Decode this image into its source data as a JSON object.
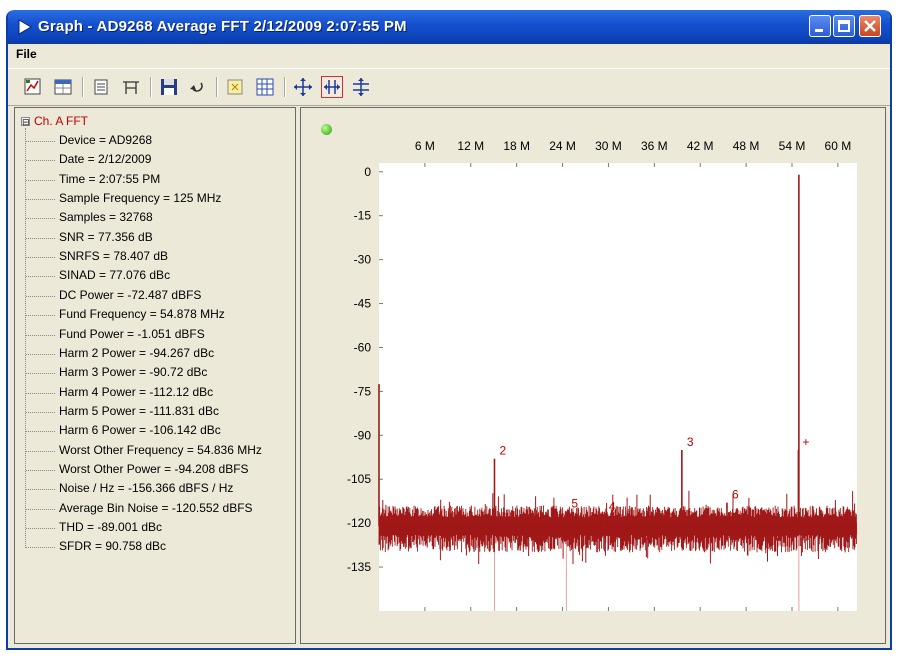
{
  "window": {
    "title": "Graph - AD9268 Average FFT 2/12/2009 2:07:55 PM",
    "title_color": "#ffffff",
    "titlebar_color": "#1551d0"
  },
  "menu": {
    "file": "File"
  },
  "toolbar": {
    "buttons": [
      "chart-icon",
      "table-icon",
      "list-icon",
      "tick-icon",
      "save-icon",
      "undo-icon",
      "marker-icon",
      "grid-icon",
      "zoom-fit-icon",
      "zoom-horizontal-icon",
      "zoom-vertical-icon"
    ],
    "active": "zoom-horizontal-icon"
  },
  "tree": {
    "root": "Ch. A FFT",
    "toggle": "⊟",
    "items": [
      "Device = AD9268",
      "Date = 2/12/2009",
      "Time = 2:07:55 PM",
      "Sample Frequency = 125 MHz",
      "Samples = 32768",
      "SNR = 77.356 dB",
      "SNRFS = 78.407 dB",
      "SINAD = 77.076 dBc",
      "DC Power = -72.487 dBFS",
      "Fund Frequency = 54.878 MHz",
      "Fund Power = -1.051 dBFS",
      "Harm 2 Power = -94.267 dBc",
      "Harm 3 Power = -90.72 dBc",
      "Harm 4 Power = -112.12 dBc",
      "Harm 5 Power = -111.831 dBc",
      "Harm 6 Power = -106.142 dBc",
      "Worst Other Frequency = 54.836 MHz",
      "Worst Other Power = -94.208 dBFS",
      "Noise / Hz = -156.366 dBFS / Hz",
      "Average Bin Noise = -120.552 dBFS",
      "THD = -89.001 dBc",
      "SFDR = 90.758 dBc"
    ]
  },
  "chart_data": {
    "type": "line",
    "x_ticks": [
      {
        "value": 6,
        "label": "6 M"
      },
      {
        "value": 12,
        "label": "12 M"
      },
      {
        "value": 18,
        "label": "18 M"
      },
      {
        "value": 24,
        "label": "24 M"
      },
      {
        "value": 30,
        "label": "30 M"
      },
      {
        "value": 36,
        "label": "36 M"
      },
      {
        "value": 42,
        "label": "42 M"
      },
      {
        "value": 48,
        "label": "48 M"
      },
      {
        "value": 54,
        "label": "54 M"
      },
      {
        "value": 60,
        "label": "60 M"
      }
    ],
    "xlim": [
      0,
      62.5
    ],
    "y_ticks": [
      0,
      -15,
      -30,
      -45,
      -60,
      -75,
      -90,
      -105,
      -120,
      -135
    ],
    "ylim": [
      -150,
      3
    ],
    "noise_floor": -121,
    "series_color": "#a01818",
    "peaks": [
      {
        "x": 0.0,
        "y": -72.5,
        "label": ""
      },
      {
        "x": 15.1,
        "y": -98,
        "label": "2"
      },
      {
        "x": 39.6,
        "y": -95,
        "label": "3"
      },
      {
        "x": 54.9,
        "y": -1.0,
        "label": ""
      },
      {
        "x": 54.84,
        "y": -95,
        "label": "+"
      },
      {
        "x": 45.5,
        "y": -113,
        "label": "6"
      },
      {
        "x": 29.4,
        "y": -117,
        "label": "4"
      },
      {
        "x": 24.5,
        "y": -116,
        "label": "5"
      }
    ],
    "marker_lines": [
      15.1,
      24.5,
      54.9
    ]
  }
}
